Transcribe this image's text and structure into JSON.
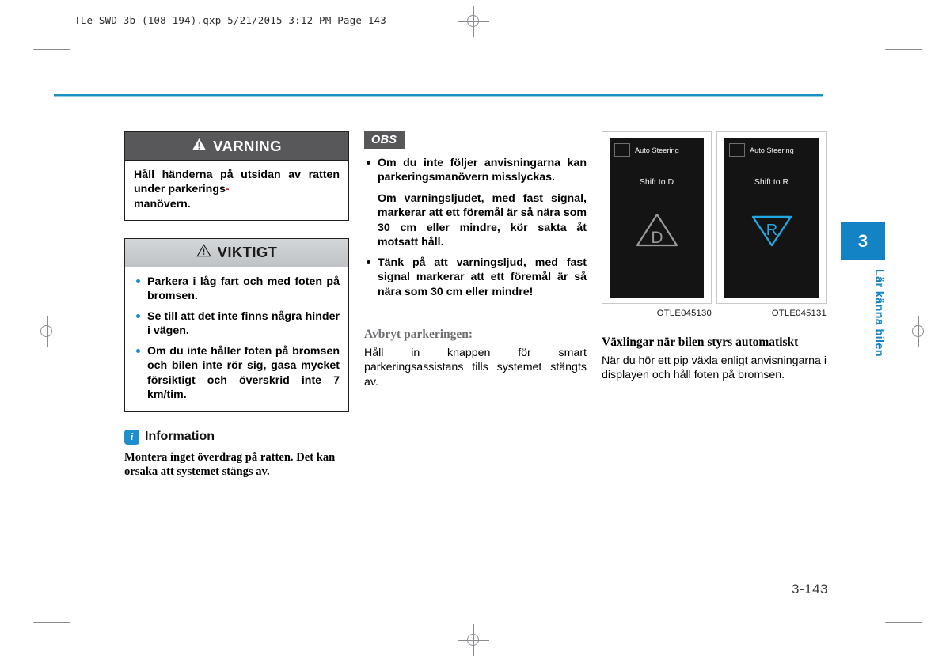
{
  "print": {
    "file_header": "TLe SWD 3b (108-194).qxp   5/21/2015   3:12 PM   Page 143",
    "page_number": "3-143"
  },
  "chapter": {
    "number": "3",
    "label": "Lär känna bilen",
    "accent_color": "#1383c6"
  },
  "left_column": {
    "warning": {
      "title": "VARNING",
      "icon": "warning-triangle-filled-icon",
      "header_bg": "#58585b",
      "text_before": "Håll händerna på utsidan av ratten under parkerings",
      "text_hyphen": "-",
      "text_after": "manövern.",
      "full_text": "Håll händerna på utsidan av ratten under parkerings-manövern."
    },
    "caution": {
      "title": "VIKTIGT",
      "icon": "warning-triangle-outline-icon",
      "header_bg": "#c9ccce",
      "items": [
        "Parkera i låg fart och med foten på bromsen.",
        "Se till att det inte finns några hinder i vägen.",
        "Om du inte håller foten på bromsen och bilen inte rör sig, gasa mycket försiktigt och överskrid inte 7 km/tim."
      ]
    },
    "information": {
      "icon": "info-icon",
      "icon_letter": "i",
      "title": "Information",
      "body": "Montera inget överdrag på ratten. Det kan orsaka att systemet stängs av."
    }
  },
  "mid_column": {
    "obs_label": "OBS",
    "obs_items": [
      {
        "main": "Om du inte följer anvisningarna kan parkeringsmanövern misslyckas.",
        "extra": "Om varningsljudet, med fast signal, markerar att ett föremål är så nära som 30 cm eller mindre, kör sakta åt motsatt håll."
      },
      {
        "main": "Tänk på att varningsljud, med fast signal markerar att ett föremål är så nära som 30 cm eller mindre!",
        "extra": ""
      }
    ],
    "cancel_heading": "Avbryt parkeringen:",
    "cancel_body": "Håll in knappen för smart parkeringsassistans tills systemet stängts av."
  },
  "right_column": {
    "figures": [
      {
        "screen_icon": "square-outline-icon",
        "screen_title": "Auto Steering",
        "screen_message": "Shift to D",
        "gear_icon": "triangle-up-d-icon",
        "gear_letter": "D",
        "gear_color": "#9a9a9a",
        "caption": "OTLE045130"
      },
      {
        "screen_icon": "square-outline-icon",
        "screen_title": "Auto Steering",
        "screen_message": "Shift to R",
        "gear_icon": "triangle-down-r-icon",
        "gear_letter": "R",
        "gear_color": "#22a8e0",
        "caption": "OTLE045131"
      }
    ],
    "section_heading": "Växlingar när bilen styrs automatiskt",
    "section_body": "När du hör ett pip växla enligt anvisningarna i displayen och håll foten på bromsen."
  }
}
